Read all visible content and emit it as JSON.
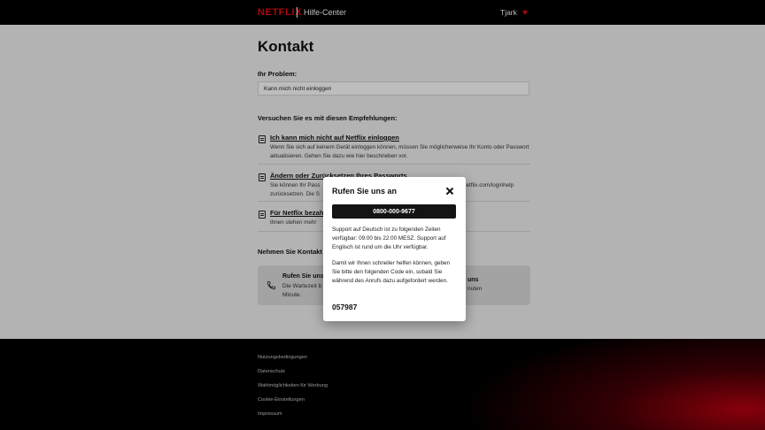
{
  "header": {
    "logo": "NETFLIX",
    "section": "Hilfe-Center",
    "user_name": "Tjark",
    "accent_color": "#e50914"
  },
  "main": {
    "title": "Kontakt",
    "problem_label": "Ihr Problem:",
    "problem_value": "Kann mich nicht einloggen",
    "recommendations_heading": "Versuchen Sie es mit diesen Empfehlungen:",
    "recommendations": [
      {
        "title": "Ich kann mich nicht auf Netflix einloggen",
        "desc": "Wenn Sie sich auf keinem Gerät einloggen können, müssen Sie möglicherweise Ihr Konto oder Passwort aktualisieren. Gehen Sie dazu wie hier beschrieben vor.",
        "icon": "document-icon"
      },
      {
        "title": "Ändern oder Zurücksetzen Ihres Passworts",
        "desc_left": "Sie können Ihr Pass",
        "desc_right": "netflix.com/loginhelp",
        "desc_line2": "zurücksetzen. Die S",
        "icon": "document-icon"
      },
      {
        "title": "Für Netflix bezah",
        "desc": "Ihnen stehen mehr",
        "icon": "document-icon"
      }
    ],
    "contact_heading": "Nehmen Sie Kontakt",
    "call": {
      "title": "Rufen Sie uns",
      "desc_line1": "Die Wartezeit b",
      "desc_line2": "Minute.",
      "icon": "phone-icon"
    },
    "chat": {
      "title": "uns",
      "desc": "nuten"
    }
  },
  "modal": {
    "title": "Rufen Sie uns an",
    "phone": "0800-000-9677",
    "support_text": "Support auf Deutsch ist zu folgenden Zeiten verfügbar: 09:00 bis 22:00 MESZ. Support auf Englisch ist rund um die Uhr verfügbar.",
    "code_text": "Damit wir Ihnen schneller helfen können, geben Sie bitte den folgenden Code ein, sobald Sie während des Anrufs dazu aufgefordert werden.",
    "code": "057987"
  },
  "footer": {
    "links": [
      "Nutzungsbedingungen",
      "Datenschutz",
      "Wahlmöglichkeiten für Werbung",
      "Cookie-Einstellungen",
      "Impressum"
    ]
  }
}
